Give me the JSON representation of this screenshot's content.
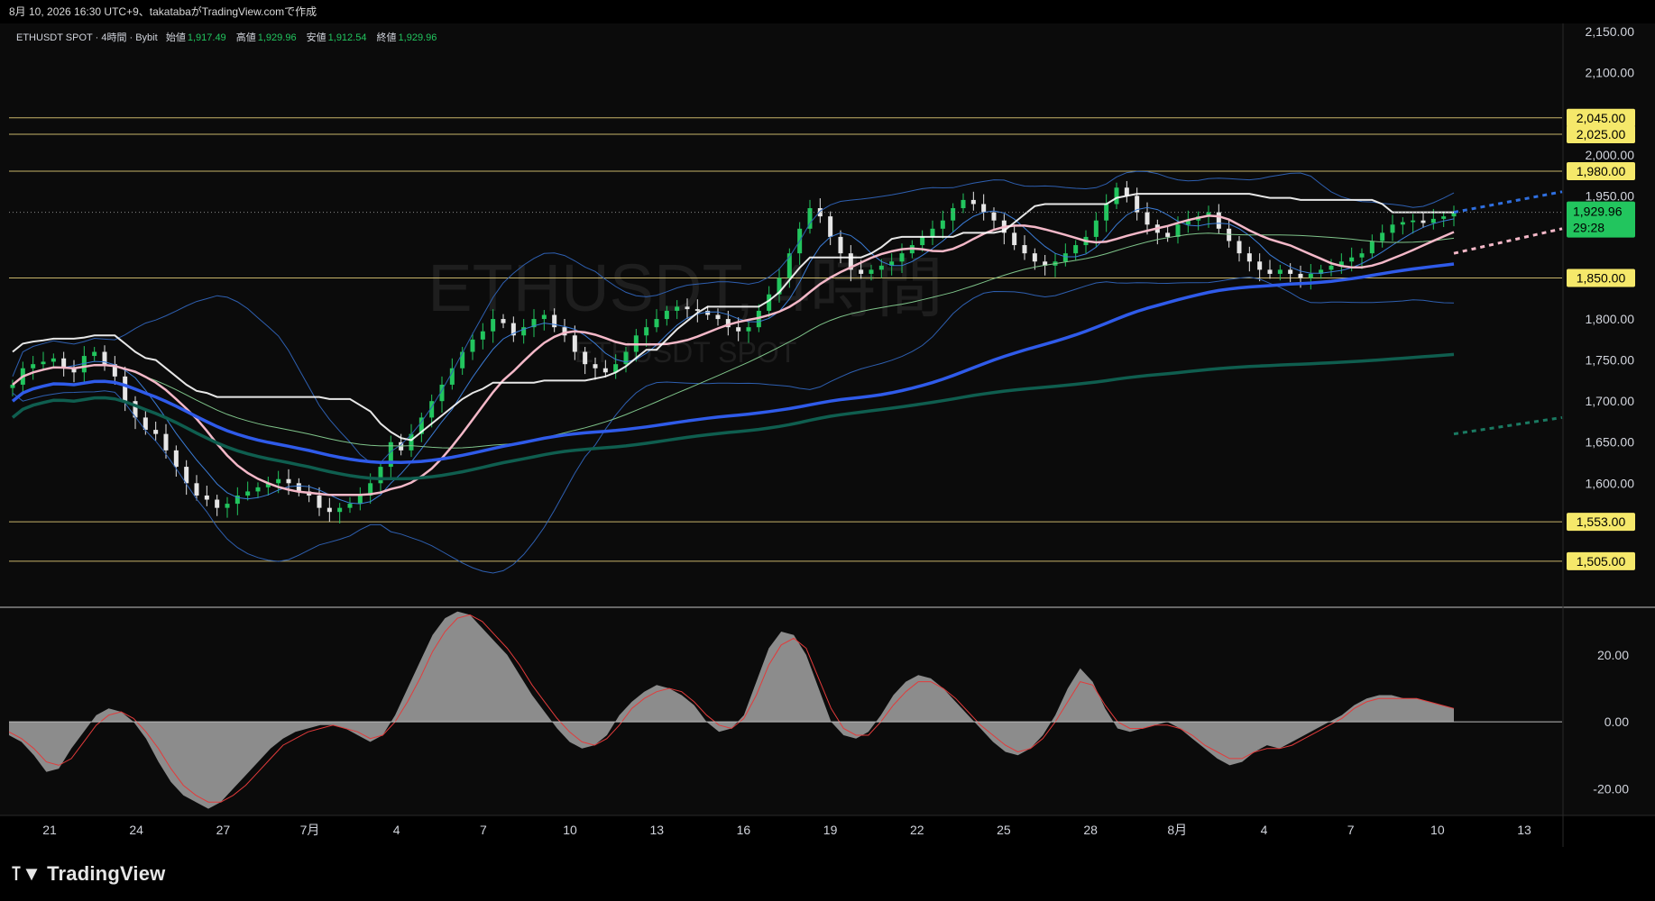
{
  "header": {
    "title": "8月 10, 2026 16:30 UTC+9、takatabaがTradingView.comで作成"
  },
  "legend": {
    "symbol": "ETHUSDT SPOT · 4時間 · Bybit",
    "open_label": "始値",
    "open": "1,917.49",
    "high_label": "高値",
    "high": "1,929.96",
    "low_label": "安値",
    "low": "1,912.54",
    "close_label": "終値",
    "close": "1,929.96"
  },
  "watermark": {
    "main": "ETHUSDT, 4時間",
    "sub": "ETHUSDT SPOT"
  },
  "brand": {
    "name": "TradingView"
  },
  "colors": {
    "up": "#22c55e",
    "down": "#e6e6e6",
    "ma_fast": "#f4b8c8",
    "ma_slow": "#2f5bea",
    "ma_long": "#0f5e4f",
    "bb": "#3a7bd5",
    "bb_outer": "#2e5fb0",
    "ichimoku": "#ffffff",
    "level": "#e8d27a",
    "price_tag": "#22c55e"
  },
  "chart_data": [
    {
      "type": "line",
      "title": "",
      "price_axis": [
        2150,
        2100,
        2000,
        1950,
        1800,
        1750,
        1700,
        1650,
        1600
      ],
      "price_axis_labels": [
        "2,150.00",
        "2,100.00",
        "2,000.00",
        "1,950.00",
        "1,800.00",
        "1,750.00",
        "1,700.00",
        "1,650.00",
        "1,600.00"
      ],
      "ylim": [
        1450,
        2160
      ],
      "time_axis_labels": [
        "21",
        "24",
        "27",
        "7月",
        "4",
        "7",
        "10",
        "13",
        "16",
        "19",
        "22",
        "25",
        "28",
        "8月",
        "4",
        "7",
        "10",
        "13"
      ],
      "horizontal_levels": [
        2045,
        2025,
        1980,
        1850,
        1553,
        1505
      ],
      "horizontal_level_labels": [
        "2,045.00",
        "2,025.00",
        "1,980.00",
        "1,850.00",
        "1,553.00",
        "1,505.00"
      ],
      "last_price": 1929.96,
      "last_price_label": "1,929.96",
      "countdown": "29:28",
      "candle_close_series": [
        1720,
        1740,
        1745,
        1748,
        1752,
        1740,
        1735,
        1755,
        1760,
        1745,
        1730,
        1700,
        1680,
        1665,
        1660,
        1640,
        1620,
        1600,
        1585,
        1580,
        1570,
        1575,
        1585,
        1590,
        1595,
        1600,
        1605,
        1600,
        1590,
        1585,
        1570,
        1565,
        1570,
        1575,
        1585,
        1600,
        1620,
        1650,
        1640,
        1660,
        1680,
        1700,
        1720,
        1740,
        1760,
        1775,
        1785,
        1800,
        1795,
        1780,
        1790,
        1800,
        1805,
        1790,
        1780,
        1760,
        1745,
        1740,
        1735,
        1745,
        1760,
        1780,
        1790,
        1800,
        1810,
        1815,
        1812,
        1810,
        1805,
        1800,
        1790,
        1785,
        1790,
        1810,
        1830,
        1850,
        1880,
        1910,
        1935,
        1925,
        1900,
        1880,
        1860,
        1855,
        1860,
        1865,
        1870,
        1880,
        1890,
        1900,
        1910,
        1920,
        1935,
        1945,
        1940,
        1930,
        1920,
        1905,
        1890,
        1880,
        1870,
        1865,
        1870,
        1880,
        1890,
        1900,
        1920,
        1940,
        1960,
        1950,
        1930,
        1915,
        1905,
        1900,
        1915,
        1920,
        1925,
        1930,
        1910,
        1895,
        1880,
        1870,
        1860,
        1855,
        1860,
        1855,
        1850,
        1855,
        1860,
        1865,
        1870,
        1875,
        1880,
        1895,
        1905,
        1915,
        1918,
        1920,
        1917,
        1922,
        1925,
        1930
      ],
      "series": [
        {
          "name": "",
          "role": "ma_fast"
        },
        {
          "name": "",
          "role": "ma_slow"
        },
        {
          "name": "",
          "role": "ma_long"
        },
        {
          "name": "",
          "role": "bollinger"
        },
        {
          "name": "",
          "role": "ichimoku_base"
        }
      ]
    },
    {
      "type": "area",
      "title": "",
      "axis": [
        20,
        0,
        -20
      ],
      "axis_labels": [
        "20.00",
        "0.00",
        "-20.00"
      ],
      "ylim": [
        -28,
        34
      ],
      "histogram": [
        -4,
        -6,
        -10,
        -15,
        -14,
        -8,
        -3,
        2,
        4,
        3,
        0,
        -5,
        -12,
        -18,
        -22,
        -24,
        -26,
        -24,
        -20,
        -16,
        -12,
        -8,
        -5,
        -3,
        -2,
        -1,
        -1,
        -2,
        -4,
        -6,
        -4,
        2,
        10,
        18,
        26,
        31,
        33,
        32,
        28,
        24,
        20,
        14,
        8,
        3,
        -2,
        -6,
        -8,
        -7,
        -4,
        2,
        6,
        9,
        11,
        10,
        8,
        5,
        0,
        -3,
        -2,
        2,
        12,
        22,
        27,
        26,
        20,
        10,
        0,
        -4,
        -5,
        -3,
        2,
        8,
        12,
        14,
        13,
        10,
        6,
        2,
        -2,
        -6,
        -9,
        -10,
        -8,
        -4,
        2,
        10,
        16,
        12,
        4,
        -2,
        -3,
        -2,
        -1,
        0,
        -2,
        -5,
        -8,
        -11,
        -13,
        -12,
        -9,
        -7,
        -8,
        -6,
        -4,
        -2,
        0,
        2,
        5,
        7,
        8,
        8,
        7,
        7,
        6,
        5,
        4
      ],
      "signal": [
        -3,
        -5,
        -8,
        -12,
        -13,
        -11,
        -6,
        -1,
        2,
        3,
        1,
        -3,
        -8,
        -14,
        -19,
        -22,
        -24,
        -24,
        -22,
        -19,
        -15,
        -11,
        -7,
        -5,
        -3,
        -2,
        -1,
        -2,
        -3,
        -5,
        -4,
        0,
        6,
        13,
        21,
        27,
        31,
        32,
        30,
        26,
        22,
        17,
        11,
        6,
        1,
        -3,
        -6,
        -7,
        -5,
        -1,
        4,
        7,
        9,
        10,
        9,
        6,
        2,
        -1,
        -2,
        1,
        8,
        17,
        23,
        25,
        22,
        13,
        4,
        -2,
        -4,
        -4,
        0,
        5,
        9,
        12,
        12,
        10,
        7,
        3,
        -1,
        -4,
        -7,
        -9,
        -8,
        -5,
        0,
        6,
        12,
        11,
        5,
        0,
        -2,
        -2,
        -1,
        -1,
        -2,
        -4,
        -7,
        -9,
        -11,
        -11,
        -9,
        -8,
        -8,
        -7,
        -5,
        -3,
        -1,
        1,
        4,
        6,
        7,
        7,
        7,
        7,
        6,
        5,
        4
      ]
    }
  ]
}
